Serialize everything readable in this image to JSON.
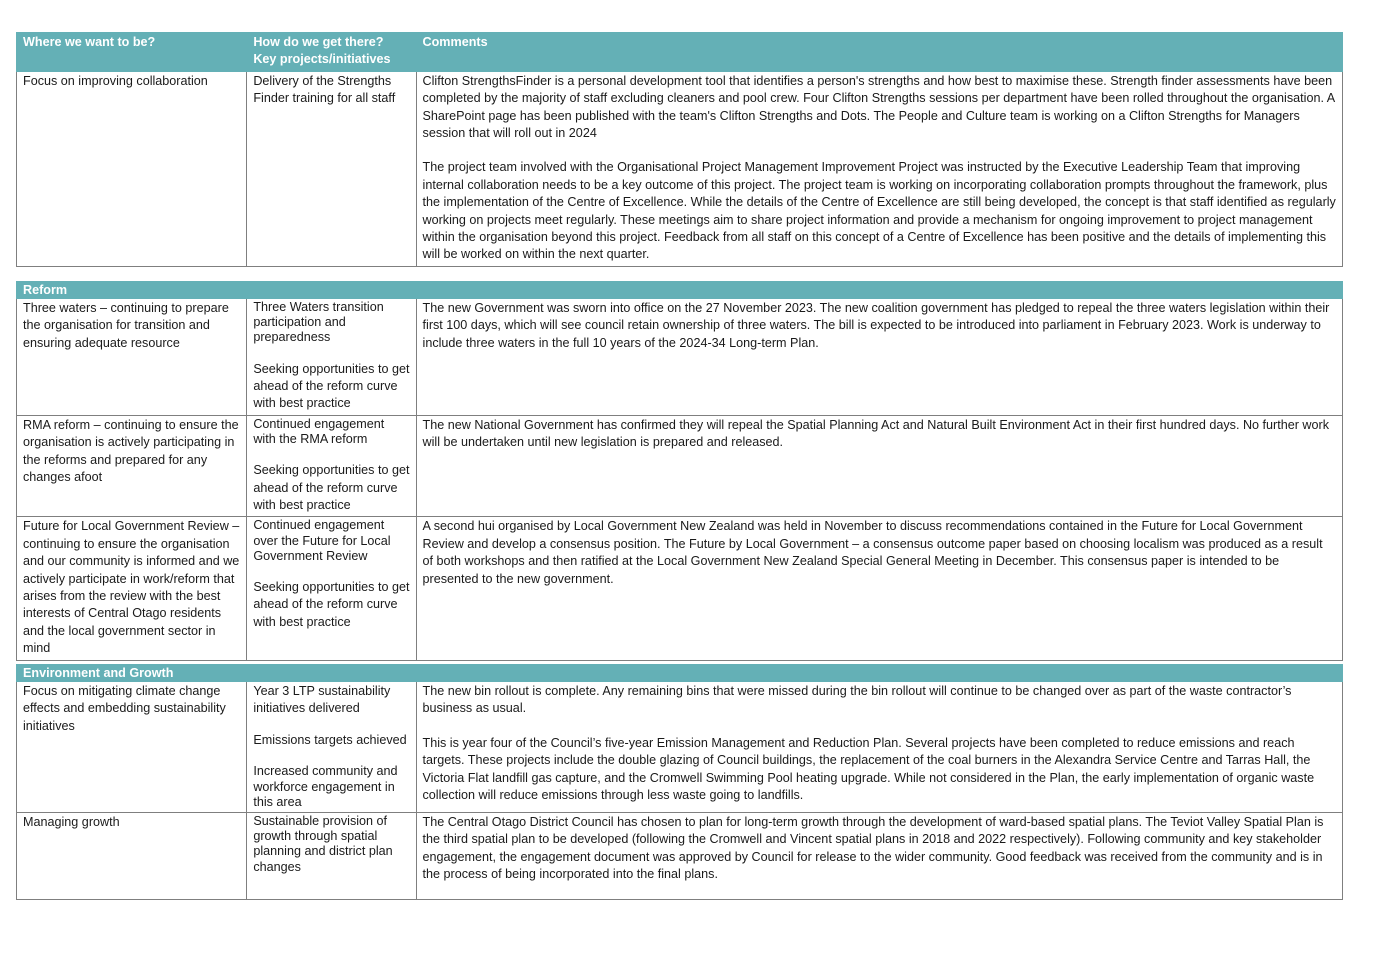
{
  "table1": {
    "headers": {
      "col1": "Where we want to be?",
      "col2_line1": "How do we get there?",
      "col2_line2": "Key projects/initiatives",
      "col3": "Comments"
    },
    "rows": [
      {
        "where": "Focus on improving collaboration",
        "how": [
          "Delivery of the Strengths Finder training for all staff"
        ],
        "comments": [
          "Clifton StrengthsFinder is a personal development tool that identifies a person's strengths and how best to maximise these. Strength finder assessments have been completed by the majority of staff excluding cleaners and pool crew. Four Clifton Strengths sessions per department have been rolled throughout the organisation.  A SharePoint page has been published with the team's Clifton Strengths and Dots.  The People and Culture team is working on a Clifton Strengths for Managers session that will roll out in 2024",
          "The project team involved with the Organisational Project Management Improvement Project was instructed by the Executive Leadership Team that improving internal collaboration needs to be a key outcome of this project. The project team is working on incorporating collaboration prompts throughout the framework, plus the implementation of the Centre of Excellence. While the details of the Centre of Excellence are still being developed, the concept is that staff identified as regularly working on projects meet regularly. These meetings aim to share project information and provide a mechanism for ongoing improvement to project management within the organisation beyond this project. Feedback from all staff on this concept of a Centre of Excellence has been positive and the details of implementing this will be worked on within the next quarter."
        ]
      }
    ]
  },
  "table2": {
    "section_title": "Reform",
    "rows": [
      {
        "where": "Three waters – continuing to prepare the organisation for transition and ensuring adequate resource",
        "how": [
          "Three Waters transition participation and preparedness",
          "Seeking opportunities to get ahead of the reform curve with best practice"
        ],
        "comments": [
          "The new Government was sworn into office on the 27 November 2023. The new coalition government has pledged to repeal the three waters legislation within their first 100 days, which will see council retain ownership of three waters. The bill is expected to be introduced into parliament in February 2023. Work is underway to include three waters in the full 10 years of the 2024-34 Long-term Plan."
        ]
      },
      {
        "where": "RMA reform – continuing to ensure the organisation is actively participating in the reforms and prepared for any changes afoot",
        "how": [
          "Continued engagement with the RMA reform",
          "Seeking opportunities to get ahead of the reform curve with best practice"
        ],
        "comments": [
          "The new National Government has confirmed they will repeal the Spatial Planning Act and Natural Built Environment Act in their first hundred days.  No further work will be undertaken until new legislation is prepared and released."
        ]
      },
      {
        "where": "Future for Local Government Review – continuing to ensure the organisation and our community is informed and we actively participate in work/reform that arises from the review with the best interests of Central Otago residents and the local government sector in mind",
        "how": [
          "Continued engagement over the Future for Local Government Review",
          "Seeking opportunities to get ahead of the reform curve with best practice"
        ],
        "comments": [
          "A second hui organised by Local Government New Zealand was held in November to discuss recommendations contained in the Future for Local Government Review and develop a consensus position. The Future by Local Government – a consensus outcome paper based on choosing localism was produced as a result of both workshops and then ratified at the Local Government New Zealand Special General Meeting in December. This consensus paper is intended to be presented to the new government."
        ]
      }
    ]
  },
  "table3": {
    "section_title": "Environment and Growth",
    "rows": [
      {
        "where": "Focus on mitigating climate change effects and embedding sustainability initiatives",
        "how": [
          "Year 3 LTP sustainability initiatives delivered",
          "Emissions targets achieved",
          "Increased community and workforce engagement in this area"
        ],
        "comments": [
          "The new bin rollout is complete. Any remaining bins that were missed during the bin rollout will continue to be changed over as part of the waste contractor’s business as usual.",
          "This is year four of the Council’s five-year Emission Management and Reduction Plan. Several projects have been completed to reduce emissions and reach targets. These projects include the double glazing of Council buildings, the replacement of the coal burners in the Alexandra Service Centre and Tarras Hall, the Victoria Flat landfill gas capture, and the Cromwell Swimming Pool heating upgrade.  While not considered in the Plan, the early implementation of organic waste collection will reduce emissions through less waste going to landfills."
        ]
      },
      {
        "where": "Managing growth",
        "how": [
          "Sustainable provision of growth through spatial planning and district plan changes"
        ],
        "comments": [
          "The Central Otago District Council has chosen to plan for long-term growth through the development of ward-based spatial plans.  The Teviot Valley Spatial Plan is the third spatial plan to be developed (following the Cromwell and Vincent spatial plans in 2018 and 2022 respectively).  Following community and key stakeholder engagement, the engagement document was approved by Council for release to the wider community.   Good feedback was received from the community and is in the process of being incorporated into the final plans."
        ]
      }
    ]
  }
}
